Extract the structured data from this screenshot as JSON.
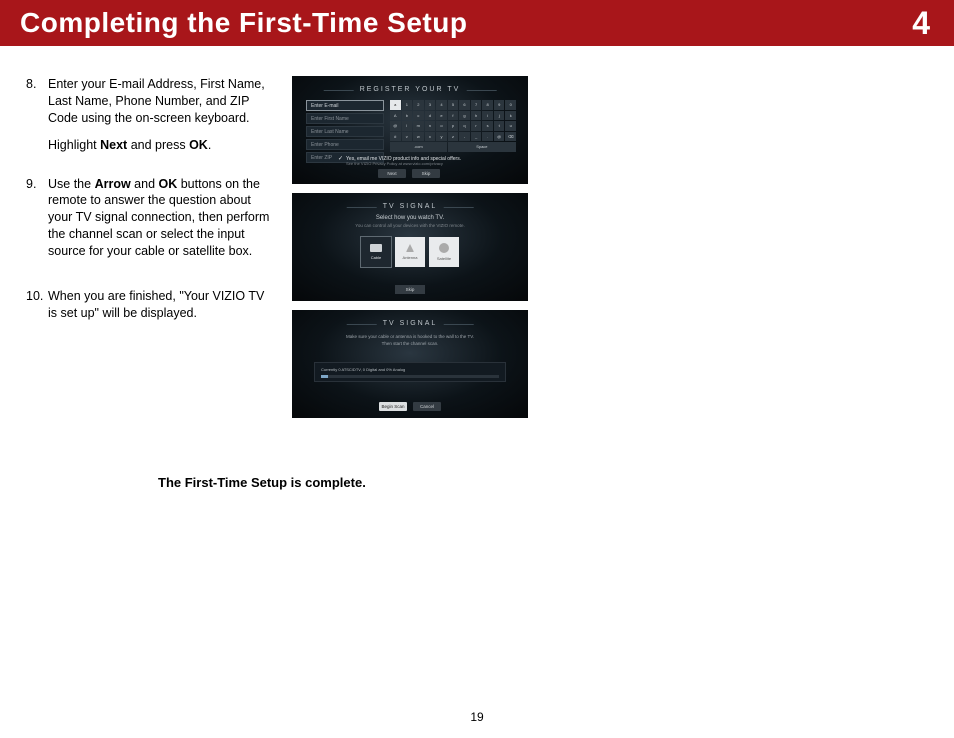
{
  "header": {
    "title": "Completing the First-Time Setup",
    "chapter": "4"
  },
  "steps": [
    {
      "num": "8.",
      "paras": [
        {
          "html": "Enter your E-mail Address, First Name, Last Name, Phone Number, and ZIP Code using the on-screen keyboard."
        },
        {
          "html": "Highlight <b>Next</b> and press <b>OK</b>."
        }
      ]
    },
    {
      "num": "9.",
      "paras": [
        {
          "html": "Use the <b>Arrow</b> and <b>OK</b> buttons on the remote to answer the question about your TV signal connection, then perform the channel scan or select the input source for your cable or satellite box."
        }
      ]
    },
    {
      "num": "10.",
      "paras": [
        {
          "html": "When you are finished, \"Your VIZIO TV is set up\" will be displayed."
        }
      ]
    }
  ],
  "screenshots": {
    "s1": {
      "title": "REGISTER YOUR TV",
      "field_active": "Enter E-mail",
      "fields": [
        "Enter First Name",
        "Enter Last Name",
        "Enter Phone",
        "Enter ZIP"
      ],
      "checkbox": "Yes, email me VIZIO product info and special offers.",
      "checkbox_sub": "See the VIZIO Privacy Policy at www.vizio.com/privacy",
      "btn_left": "Next",
      "btn_right": "Skip"
    },
    "s2": {
      "title": "TV SIGNAL",
      "sub1": "Select how you watch TV.",
      "sub2": "You can control all your devices with the VIZIO remote.",
      "cards": [
        "Cable",
        "Antenna",
        "Satellite"
      ],
      "skip": "Skip"
    },
    "s3": {
      "title": "TV SIGNAL",
      "sub1": "Make sure your cable or antenna is hooked to the wall to the TV.",
      "sub2": "Then start the channel scan.",
      "progress_text": "Currently 0 ATSC/DTV, 0 Digital and 0% Analog",
      "btn_left": "Begin Scan",
      "btn_right": "Cancel"
    }
  },
  "complete_line": "The First-Time Setup is complete.",
  "page_number": "19"
}
